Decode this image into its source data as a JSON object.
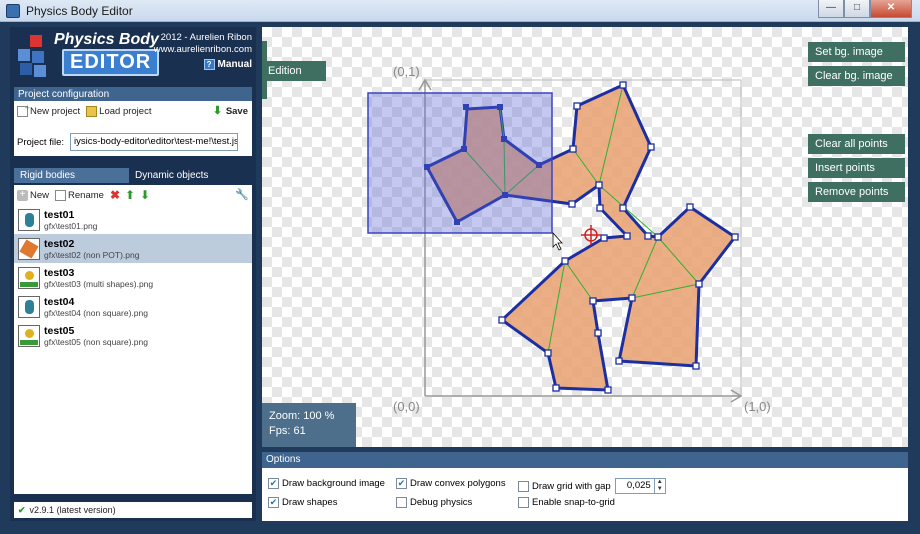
{
  "window": {
    "title": "Physics Body Editor"
  },
  "logo": {
    "title": "Physics Body",
    "subtitle": "EDITOR"
  },
  "credits": {
    "line1": "2012 - Aurelien Ribon",
    "line2": "www.aurelienribon.com",
    "manual": "Manual"
  },
  "project": {
    "header": "Project configuration",
    "new_label": "New project",
    "load_label": "Load project",
    "save_label": "Save",
    "file_label": "Project file:",
    "file_value": "iysics-body-editor\\editor\\test-me!\\test.json"
  },
  "tabs": {
    "rigid": "Rigid bodies",
    "dynamic": "Dynamic objects"
  },
  "bodies_toolbar": {
    "new_label": "New",
    "rename_label": "Rename"
  },
  "bodies": [
    {
      "name": "test01",
      "path": "gfx\\test01.png"
    },
    {
      "name": "test02",
      "path": "gfx\\test02 (non POT).png"
    },
    {
      "name": "test03",
      "path": "gfx\\test03 (multi shapes).png"
    },
    {
      "name": "test04",
      "path": "gfx\\test04 (non square).png"
    },
    {
      "name": "test05",
      "path": "gfx\\test05 (non square).png"
    }
  ],
  "version": "v2.9.1 (latest version)",
  "canvas": {
    "mode_tab": "Edition",
    "buttons": {
      "set_bg": "Set bg. image",
      "clear_bg": "Clear bg. image",
      "clear_points": "Clear all points",
      "insert_points": "Insert points",
      "remove_points": "Remove points"
    },
    "axis_labels": {
      "top_left": "(0,1)",
      "bottom_left": "(0,0)",
      "bottom_right": "(1,0)"
    },
    "zoom": "Zoom: 100 %",
    "fps": "Fps: 61"
  },
  "options": {
    "header": "Options",
    "draw_bg": "Draw background image",
    "draw_shapes": "Draw shapes",
    "draw_convex": "Draw convex polygons",
    "debug_physics": "Debug physics",
    "draw_grid": "Draw grid with gap",
    "snap_grid": "Enable snap-to-grid",
    "grid_gap": "0,025"
  },
  "colors": {
    "panel": "#1a3050",
    "header": "#3f648e",
    "canvas_button": "#3e6f60",
    "shape_fill": "#e8a070",
    "shape_stroke": "#1c2fa0",
    "selection": "#5a64d8"
  }
}
